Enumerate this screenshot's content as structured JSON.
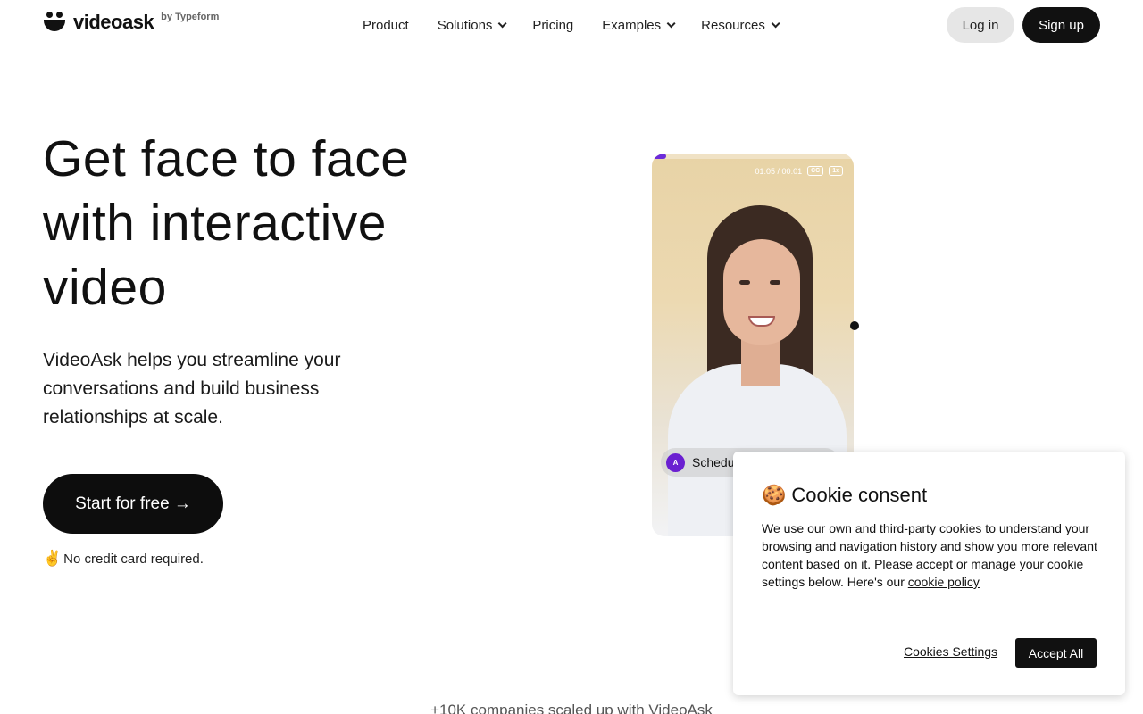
{
  "header": {
    "logo_text": "videoask",
    "logo_by": "by Typeform",
    "nav": [
      {
        "label": "Product",
        "dropdown": false
      },
      {
        "label": "Solutions",
        "dropdown": true
      },
      {
        "label": "Pricing",
        "dropdown": false
      },
      {
        "label": "Examples",
        "dropdown": true
      },
      {
        "label": "Resources",
        "dropdown": true
      }
    ],
    "login_label": "Log in",
    "signup_label": "Sign up"
  },
  "hero": {
    "title": "Get face to face with interactive video",
    "subtitle": "VideoAsk helps you streamline your conversations and build business relationships at scale.",
    "cta_label": "Start for free →",
    "note_emoji": "✌️",
    "note": "No credit card required."
  },
  "video": {
    "time": "01:05 / 00:01",
    "cc_label": "CC",
    "speed_label": "1x",
    "avatar_letter": "A",
    "option_label": "Schedu"
  },
  "companies_text": "+10K companies scaled up with VideoAsk",
  "cookie": {
    "emoji": "🍪",
    "title": "Cookie consent",
    "body": "We use our own and third-party cookies to understand your browsing and navigation history and show you more relevant content based on it. Please accept or manage your cookie settings below. Here's our ",
    "policy_link": "cookie policy",
    "settings_label": "Cookies Settings",
    "accept_label": "Accept All"
  },
  "colors": {
    "primary_button": "#111111",
    "progress_accent": "#6c2bd9",
    "avatar_accent": "#6a1fd1"
  }
}
